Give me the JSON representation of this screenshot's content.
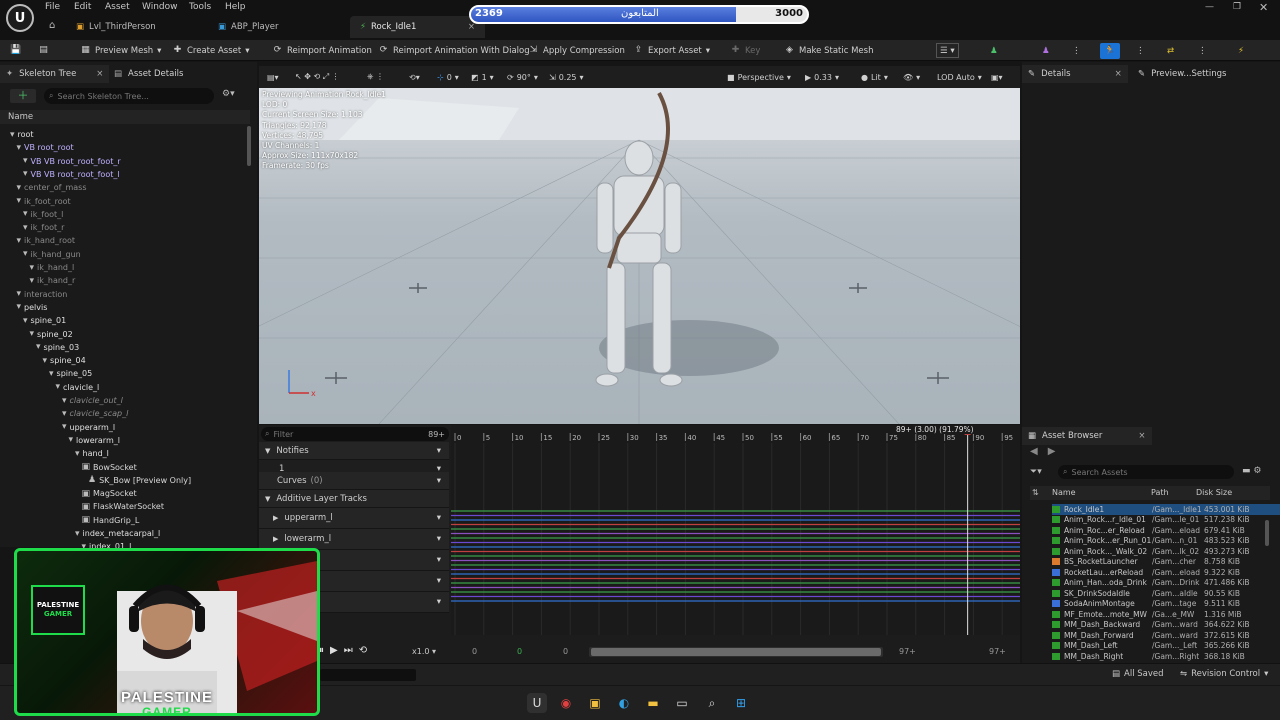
{
  "menu": [
    "File",
    "Edit",
    "Asset",
    "Window",
    "Tools",
    "Help"
  ],
  "tabs": [
    {
      "label": "Lvl_ThirdPerson"
    },
    {
      "label": "ABP_Player"
    },
    {
      "label": "Rock_Idle1"
    }
  ],
  "followers": {
    "current": "2369",
    "label": "المتابعون",
    "goal": "3000",
    "progress": 0.79
  },
  "toolbar": {
    "preview_mesh": "Preview Mesh",
    "create_asset": "Create Asset",
    "reimport": "Reimport Animation",
    "reimport_dialog": "Reimport Animation With Dialog",
    "apply_compression": "Apply Compression",
    "export_asset": "Export Asset",
    "key": "Key",
    "make_static_mesh": "Make Static Mesh"
  },
  "skeleton": {
    "tab1": "Skeleton Tree",
    "tab2": "Asset Details",
    "search_placeholder": "Search Skeleton Tree...",
    "column": "Name",
    "nodes": [
      {
        "label": "root",
        "kind": "bone"
      },
      {
        "label": "VB root_root",
        "kind": "vb"
      },
      {
        "label": "VB VB root_root_foot_r",
        "kind": "vb"
      },
      {
        "label": "VB VB root_root_foot_l",
        "kind": "vb"
      },
      {
        "label": "center_of_mass",
        "kind": "dim"
      },
      {
        "label": "ik_foot_root",
        "kind": "dim"
      },
      {
        "label": "ik_foot_l",
        "kind": "dim"
      },
      {
        "label": "ik_foot_r",
        "kind": "dim"
      },
      {
        "label": "ik_hand_root",
        "kind": "dim"
      },
      {
        "label": "ik_hand_gun",
        "kind": "dim"
      },
      {
        "label": "ik_hand_l",
        "kind": "dim"
      },
      {
        "label": "ik_hand_r",
        "kind": "dim"
      },
      {
        "label": "interaction",
        "kind": "dim"
      },
      {
        "label": "pelvis",
        "kind": "bone"
      },
      {
        "label": "spine_01",
        "kind": "bone"
      },
      {
        "label": "spine_02",
        "kind": "bone"
      },
      {
        "label": "spine_03",
        "kind": "bone"
      },
      {
        "label": "spine_04",
        "kind": "bone"
      },
      {
        "label": "spine_05",
        "kind": "bone"
      },
      {
        "label": "clavicle_l",
        "kind": "bone"
      },
      {
        "label": "clavicle_out_l",
        "kind": "ital"
      },
      {
        "label": "clavicle_scap_l",
        "kind": "ital"
      },
      {
        "label": "upperarm_l",
        "kind": "bone"
      },
      {
        "label": "lowerarm_l",
        "kind": "bone"
      },
      {
        "label": "hand_l",
        "kind": "bone"
      },
      {
        "label": "BowSocket",
        "kind": "sock"
      },
      {
        "label": "SK_Bow [Preview Only]",
        "kind": "mesh"
      },
      {
        "label": "MagSocket",
        "kind": "sock"
      },
      {
        "label": "FlaskWaterSocket",
        "kind": "sock"
      },
      {
        "label": "HandGrip_L",
        "kind": "sock"
      },
      {
        "label": "index_metacarpal_l",
        "kind": "bone"
      },
      {
        "label": "index_01_l",
        "kind": "bone"
      }
    ]
  },
  "viewport": {
    "perspective": "Perspective",
    "fov": "0.33",
    "lit": "Lit",
    "lod": "LOD Auto",
    "snap_angle": "90°",
    "snap_scale": "0.25",
    "snap_grid": "0",
    "cam": "1",
    "stats": [
      "Previewing Animation Rock_Idle1",
      "LOD: 0",
      "Current Screen Size: 1.103",
      "Triangles: 92,178",
      "Vertices: 48,795",
      "UV Channels: 1",
      "Approx Size: 111x70x182",
      "Framerate: 30 fps"
    ]
  },
  "timeline": {
    "filter_placeholder": "Filter",
    "frames": "89+",
    "notifies": "Notifies",
    "notify_track": "1",
    "curves": "Curves",
    "curves_count": "(0)",
    "additive": "Additive Layer Tracks",
    "tracks": [
      "upperarm_l",
      "lowerarm_l"
    ],
    "ticks": [
      "0",
      "5",
      "10",
      "15",
      "20",
      "25",
      "30",
      "35",
      "40",
      "45",
      "50",
      "55",
      "60",
      "65",
      "70",
      "75",
      "80",
      "85",
      "90",
      "95"
    ],
    "playhead": "89+ (3.00) (91.79%)",
    "speed": "x1.0",
    "start": "0",
    "start2": "0",
    "start3": "0",
    "end": "97+",
    "end2": "97+"
  },
  "details": {
    "tab": "Details",
    "tab2": "Preview...Settings"
  },
  "asset_browser": {
    "tab": "Asset Browser",
    "search_placeholder": "Search Assets",
    "cols": [
      "Name",
      "Path",
      "Disk Size"
    ],
    "rows": [
      {
        "name": "Rock_Idle1",
        "path": "/Gam..._Idle1",
        "size": "453.001 KiB",
        "color": "#2e9b2e"
      },
      {
        "name": "Anim_Rock...r_Idle_01",
        "path": "/Gam...le_01",
        "size": "517.238 KiB",
        "color": "#2e9b2e"
      },
      {
        "name": "Anim_Roc...er_Reload",
        "path": "/Gam...eload",
        "size": "679.41 KiB",
        "color": "#2e9b2e"
      },
      {
        "name": "Anim_Rock...er_Run_01",
        "path": "/Gam...n_01",
        "size": "483.523 KiB",
        "color": "#2e9b2e"
      },
      {
        "name": "Anim_Rock..._Walk_02",
        "path": "/Gam...lk_02",
        "size": "493.273 KiB",
        "color": "#2e9b2e"
      },
      {
        "name": "BS_RocketLauncher",
        "path": "/Gam...cher",
        "size": "8.758 KiB",
        "color": "#d97a2e"
      },
      {
        "name": "RocketLau...erReload",
        "path": "/Gam...eload",
        "size": "9.322 KiB",
        "color": "#3a6fd8"
      },
      {
        "name": "Anim_Han...oda_Drink",
        "path": "/Gam...Drink",
        "size": "471.486 KiB",
        "color": "#2e9b2e"
      },
      {
        "name": "SK_DrinkSodaIdle",
        "path": "/Gam...aIdle",
        "size": "90.55 KiB",
        "color": "#2e9b2e"
      },
      {
        "name": "SodaAnimMontage",
        "path": "/Gam...tage",
        "size": "9.511 KiB",
        "color": "#3a6fd8"
      },
      {
        "name": "MF_Emote...mote_MW",
        "path": "/Ga...e_MW",
        "size": "1.316 MiB",
        "color": "#2e9b2e"
      },
      {
        "name": "MM_Dash_Backward",
        "path": "/Gam...ward",
        "size": "364.622 KiB",
        "color": "#2e9b2e"
      },
      {
        "name": "MM_Dash_Forward",
        "path": "/Gam...ward",
        "size": "372.615 KiB",
        "color": "#2e9b2e"
      },
      {
        "name": "MM_Dash_Left",
        "path": "/Gam..._Left",
        "size": "365.266 KiB",
        "color": "#2e9b2e"
      },
      {
        "name": "MM_Dash_Right",
        "path": "/Gam...Right",
        "size": "368.18 KiB",
        "color": "#2e9b2e"
      }
    ]
  },
  "status": {
    "all_saved": "All Saved",
    "revision_control": "Revision Control"
  },
  "webcam": {
    "brand1": "PALESTINE",
    "brand2": "GAMER",
    "logo1": "PALESTINE",
    "logo2": "GAMER"
  }
}
